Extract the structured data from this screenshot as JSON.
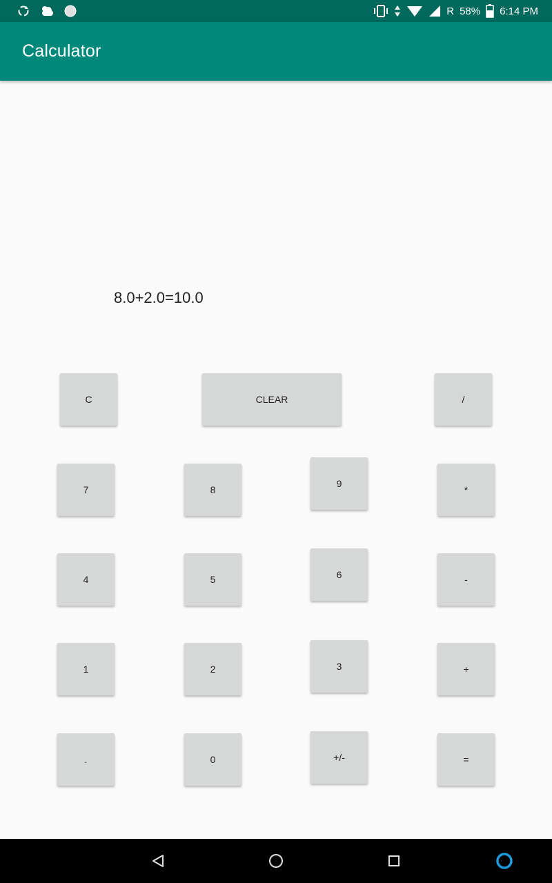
{
  "status_bar": {
    "battery": "58%",
    "roaming": "R",
    "time": "6:14 PM"
  },
  "app_bar": {
    "title": "Calculator"
  },
  "display": {
    "text": "8.0+2.0=10.0"
  },
  "buttons": {
    "c": "C",
    "clear": "CLEAR",
    "divide": "/",
    "seven": "7",
    "eight": "8",
    "nine": "9",
    "multiply": "*",
    "four": "4",
    "five": "5",
    "six": "6",
    "minus": "-",
    "one": "1",
    "two": "2",
    "three": "3",
    "plus": "+",
    "dot": ".",
    "zero": "0",
    "plus_minus": "+/-",
    "equals": "="
  },
  "colors": {
    "status_bar": "#00695c",
    "app_bar": "#00897b",
    "button": "#d6d7d7",
    "background": "#fafafa"
  },
  "icons": {
    "status_left": [
      "sync-icon",
      "weather-icon",
      "circle-icon"
    ],
    "status_right": [
      "vibrate-icon",
      "data-arrows-icon",
      "wifi-icon",
      "signal-icon",
      "battery-icon"
    ],
    "nav": [
      "back-icon",
      "home-icon",
      "recents-icon",
      "assistant-icon"
    ]
  }
}
